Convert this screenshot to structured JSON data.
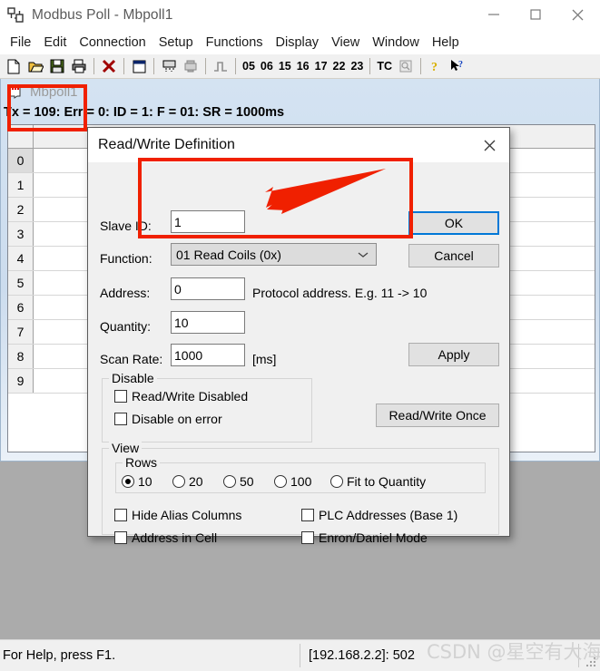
{
  "window": {
    "title": "Modbus Poll - Mbpoll1",
    "icon": "modbus-app-icon",
    "controls": {
      "minimize": "—",
      "maximize": "☐",
      "close": "✕"
    }
  },
  "menubar": {
    "items": [
      "File",
      "Edit",
      "Connection",
      "Setup",
      "Functions",
      "Display",
      "View",
      "Window",
      "Help"
    ]
  },
  "toolbar": {
    "icons": [
      "new-document-icon",
      "open-folder-icon",
      "save-disk-icon",
      "print-icon",
      "delete-x-icon",
      "window-icon",
      "read-write-icon",
      "poll-icon",
      "signal-icon"
    ],
    "function_codes": [
      "05",
      "06",
      "15",
      "16",
      "17",
      "22",
      "23"
    ],
    "tc_label": "TC",
    "tc_icon": "tc-window-icon",
    "help_icon": "help-key-icon",
    "context_help_icon": "context-help-arrow-icon"
  },
  "mdi_child": {
    "title": "Mbpoll1",
    "icon": "mbpoll-doc-icon",
    "status_line": "Tx = 109: Err = 0: ID = 1: F = 01: SR = 1000ms",
    "grid": {
      "row_headers": [
        "0",
        "1",
        "2",
        "3",
        "4",
        "5",
        "6",
        "7",
        "8",
        "9"
      ]
    }
  },
  "dialog": {
    "title": "Read/Write Definition",
    "close_icon": "close-icon",
    "fields": {
      "slave_id_label": "Slave ID:",
      "slave_id_value": "1",
      "function_label": "Function:",
      "function_value": "01 Read Coils (0x)",
      "address_label": "Address:",
      "address_value": "0",
      "address_hint": "Protocol address. E.g. 11 -> 10",
      "quantity_label": "Quantity:",
      "quantity_value": "10",
      "scan_rate_label": "Scan Rate:",
      "scan_rate_value": "1000",
      "scan_rate_unit": "[ms]"
    },
    "buttons": {
      "ok": "OK",
      "cancel": "Cancel",
      "apply": "Apply",
      "read_write_once": "Read/Write Once"
    },
    "disable_group": {
      "title": "Disable",
      "read_write_disabled": {
        "label": "Read/Write Disabled",
        "checked": false
      },
      "disable_on_error": {
        "label": "Disable on error",
        "checked": false
      }
    },
    "view_group": {
      "title": "View",
      "rows_group_title": "Rows",
      "rows_options": [
        {
          "label": "10",
          "selected": true
        },
        {
          "label": "20",
          "selected": false
        },
        {
          "label": "50",
          "selected": false
        },
        {
          "label": "100",
          "selected": false
        },
        {
          "label": "Fit to Quantity",
          "selected": false
        }
      ],
      "checkboxes": [
        {
          "label": "Hide Alias Columns",
          "checked": false
        },
        {
          "label": "PLC Addresses (Base 1)",
          "checked": false
        },
        {
          "label": "Address in Cell",
          "checked": false
        },
        {
          "label": "Enron/Daniel Mode",
          "checked": false
        }
      ]
    }
  },
  "statusbar": {
    "left": "For Help, press F1.",
    "connection": "[192.168.2.2]: 502",
    "watermark": "CSDN @星空有大海"
  },
  "annotations": {
    "highlight_color": "#f02000",
    "rect_mdi_label": "red-highlight-mbpoll-title",
    "rect_dialog_label": "red-highlight-slave-function",
    "arrow_label": "red-arrow-pointing-to-function"
  }
}
